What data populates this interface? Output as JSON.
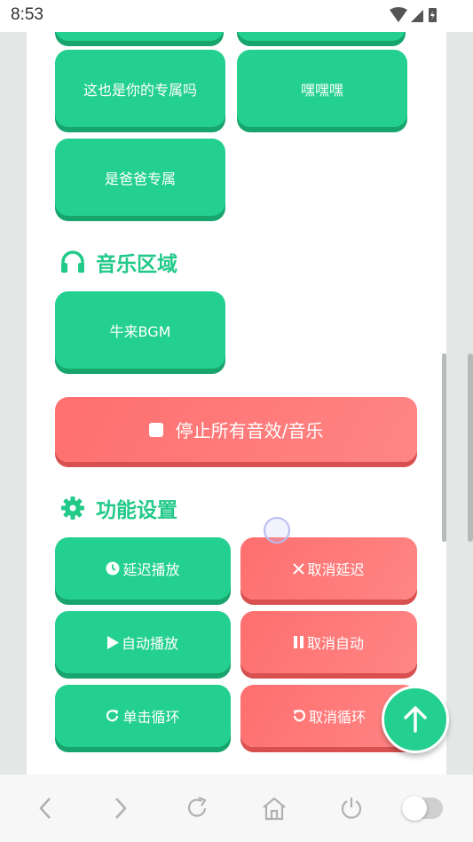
{
  "status": {
    "time": "8:53"
  },
  "buttons": {
    "exclusive_you": "这也是你的专属吗",
    "heiheihei": "嘿嘿嘿",
    "dad_exclusive": "是爸爸专属"
  },
  "music_section": {
    "title": "音乐区域",
    "bgm_button": "牛来BGM",
    "stop_all": "停止所有音效/音乐"
  },
  "settings_section": {
    "title": "功能设置",
    "delay_play": "延迟播放",
    "cancel_delay": "取消延迟",
    "auto_play": "自动播放",
    "cancel_auto": "取消自动",
    "single_loop": "单击循环",
    "cancel_loop": "取消循环"
  },
  "colors": {
    "accent_green": "#23d08f",
    "accent_red": "#ff7676"
  },
  "icons": [
    "headphones-icon",
    "gear-icon",
    "clock-icon",
    "close-icon",
    "play-icon",
    "pause-icon",
    "redo-icon",
    "undo-icon",
    "arrow-up-icon",
    "back-icon",
    "forward-icon",
    "refresh-icon",
    "home-icon",
    "power-icon"
  ]
}
